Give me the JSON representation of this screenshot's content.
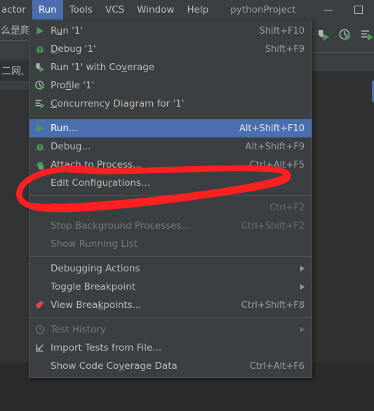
{
  "window": {
    "title": "pythonProject",
    "minimize_label": "—",
    "maximize_label": "□"
  },
  "menubar": {
    "items": [
      {
        "label": "actor",
        "mnemonic": "",
        "active": false,
        "clipped": true
      },
      {
        "label": "Run",
        "mnemonic": "u",
        "active": true
      },
      {
        "label": "Tools",
        "mnemonic": "T",
        "active": false
      },
      {
        "label": "VCS",
        "mnemonic": "S",
        "active": false
      },
      {
        "label": "Window",
        "mnemonic": "W",
        "active": false
      },
      {
        "label": "Help",
        "mnemonic": "H",
        "active": false
      }
    ]
  },
  "background": {
    "left_text_row_a": "么是爬",
    "left_text_row_b": "二网,",
    "toolbar_icons": [
      "run-with-coverage-icon",
      "profile-icon",
      "concurrency-diagram-icon"
    ]
  },
  "run_menu": {
    "groups": [
      {
        "items": [
          {
            "label": "Run '1'",
            "mnemonic": "u",
            "shortcut": "Shift+F10",
            "icon": "run-green-triangle-icon",
            "state": "normal",
            "submenu": false
          },
          {
            "label": "Debug '1'",
            "mnemonic": "D",
            "shortcut": "Shift+F9",
            "icon": "debug-bug-icon",
            "state": "normal",
            "submenu": false
          },
          {
            "label": "Run '1' with Coverage",
            "mnemonic": "v",
            "shortcut": "",
            "icon": "run-with-coverage-icon",
            "state": "normal",
            "submenu": false
          },
          {
            "label": "Profile '1'",
            "mnemonic": "f",
            "shortcut": "",
            "icon": "profile-icon",
            "state": "normal",
            "submenu": false
          },
          {
            "label": "Concurrency Diagram for '1'",
            "mnemonic": "C",
            "shortcut": "",
            "icon": "concurrency-diagram-icon",
            "state": "normal",
            "submenu": false
          }
        ]
      },
      {
        "items": [
          {
            "label": "Run...",
            "mnemonic": "",
            "shortcut": "Alt+Shift+F10",
            "icon": "run-green-triangle-icon",
            "state": "selected",
            "submenu": false
          },
          {
            "label": "Debug...",
            "mnemonic": "",
            "shortcut": "Alt+Shift+F9",
            "icon": "debug-bug-icon",
            "state": "normal",
            "submenu": false
          },
          {
            "label": "Attach to Process...",
            "mnemonic": "",
            "shortcut": "Ctrl+Alt+F5",
            "icon": "attach-to-process-icon",
            "state": "normal",
            "submenu": false
          },
          {
            "label": "Edit Configurations...",
            "mnemonic": "r",
            "shortcut": "",
            "icon": "none",
            "state": "normal",
            "submenu": false
          }
        ]
      },
      {
        "items": [
          {
            "label": "Stop",
            "mnemonic": "",
            "shortcut": "Ctrl+F2",
            "icon": "stop-square-icon",
            "state": "disabled",
            "submenu": false
          },
          {
            "label": "Stop Background Processes...",
            "mnemonic": "",
            "shortcut": "Ctrl+Shift+F2",
            "icon": "none",
            "state": "disabled",
            "submenu": false
          },
          {
            "label": "Show Running List",
            "mnemonic": "",
            "shortcut": "",
            "icon": "none",
            "state": "disabled",
            "submenu": false
          }
        ]
      },
      {
        "items": [
          {
            "label": "Debugging Actions",
            "mnemonic": "",
            "shortcut": "",
            "icon": "none",
            "state": "normal",
            "submenu": true
          },
          {
            "label": "Toggle Breakpoint",
            "mnemonic": "",
            "shortcut": "",
            "icon": "none",
            "state": "normal",
            "submenu": true
          },
          {
            "label": "View Breakpoints...",
            "mnemonic": "k",
            "shortcut": "Ctrl+Shift+F8",
            "icon": "breakpoints-red-dots-icon",
            "state": "normal",
            "submenu": false
          }
        ]
      },
      {
        "items": [
          {
            "label": "Test History",
            "mnemonic": "",
            "shortcut": "",
            "icon": "clock-history-icon",
            "state": "disabled",
            "submenu": true
          },
          {
            "label": "Import Tests from File...",
            "mnemonic": "",
            "shortcut": "",
            "icon": "import-tests-icon",
            "state": "normal",
            "submenu": false
          },
          {
            "label": "Show Code Coverage Data",
            "mnemonic": "v",
            "shortcut": "Ctrl+Alt+F6",
            "icon": "none",
            "state": "normal",
            "submenu": false
          }
        ]
      }
    ]
  },
  "annotation": {
    "type": "hand-drawn-ellipse",
    "color": "#fc2020",
    "target_label": "Edit Configurations..."
  },
  "colors": {
    "menu_background": "#3c3f41",
    "menu_selection": "#4b6eaf",
    "menu_text": "#bbbbbb",
    "menu_text_disabled": "#777777",
    "editor_background": "#2f3132",
    "window_background": "#2b2b2b",
    "accent_green": "#499c54",
    "annotation_red": "#fc2020"
  }
}
